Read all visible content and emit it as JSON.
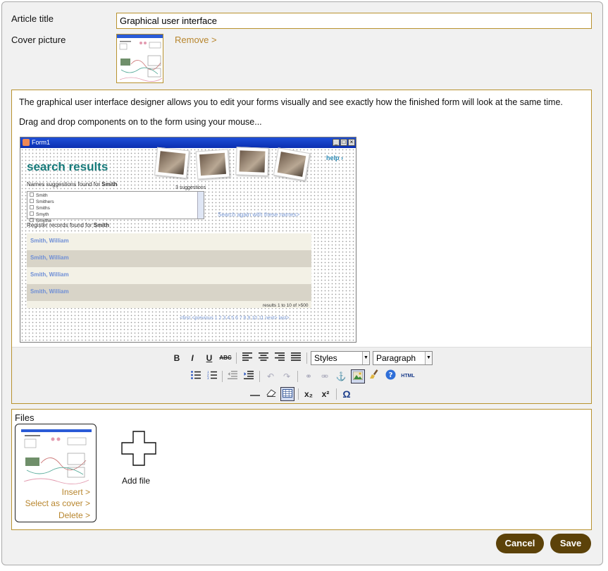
{
  "form": {
    "article_title_label": "Article title",
    "article_title_value": "Graphical user interface",
    "cover_picture_label": "Cover picture",
    "remove_link": "Remove >"
  },
  "editor": {
    "paragraph_1": "The graphical user interface designer allows you to edit your forms visually and see exactly how the finished form will look at the same time.",
    "paragraph_2": "Drag and drop components on to the form using your mouse...",
    "screenshot": {
      "window_title": "Form1",
      "heading": "search results",
      "help_link": "help",
      "names_label": "Names suggestions found for",
      "names_term": "Smith",
      "suggestions_count": "3 suggestions",
      "names": [
        "Smith",
        "Smithers",
        "Smiths",
        "Smyth",
        "Smythe"
      ],
      "search_again": "Search again with these names>",
      "register_label": "Register records found for",
      "register_term": "Smith",
      "results": [
        "Smith, William",
        "Smith, William",
        "Smith, William",
        "Smith, William"
      ],
      "results_count": "results 1 to 10 of >500",
      "pagination": "<first  <previous 1 2 3 4 5 6 7 8 9 10 11 next> last>"
    },
    "toolbar": {
      "styles_select": "Styles",
      "format_select": "Paragraph",
      "html_label": "HTML",
      "bold": "B",
      "italic": "I",
      "underline": "U",
      "strike": "ABC",
      "subscript": "x₂",
      "superscript": "x²",
      "omega": "Ω"
    }
  },
  "files": {
    "heading": "Files",
    "actions": {
      "insert": "Insert >",
      "select_cover": "Select as cover >",
      "delete": "Delete >"
    },
    "add_file": "Add file"
  },
  "buttons": {
    "cancel": "Cancel",
    "save": "Save"
  },
  "colors": {
    "accent_gold": "#b8922e",
    "button_brown": "#5c4209",
    "teal_heading": "#167a7a"
  }
}
